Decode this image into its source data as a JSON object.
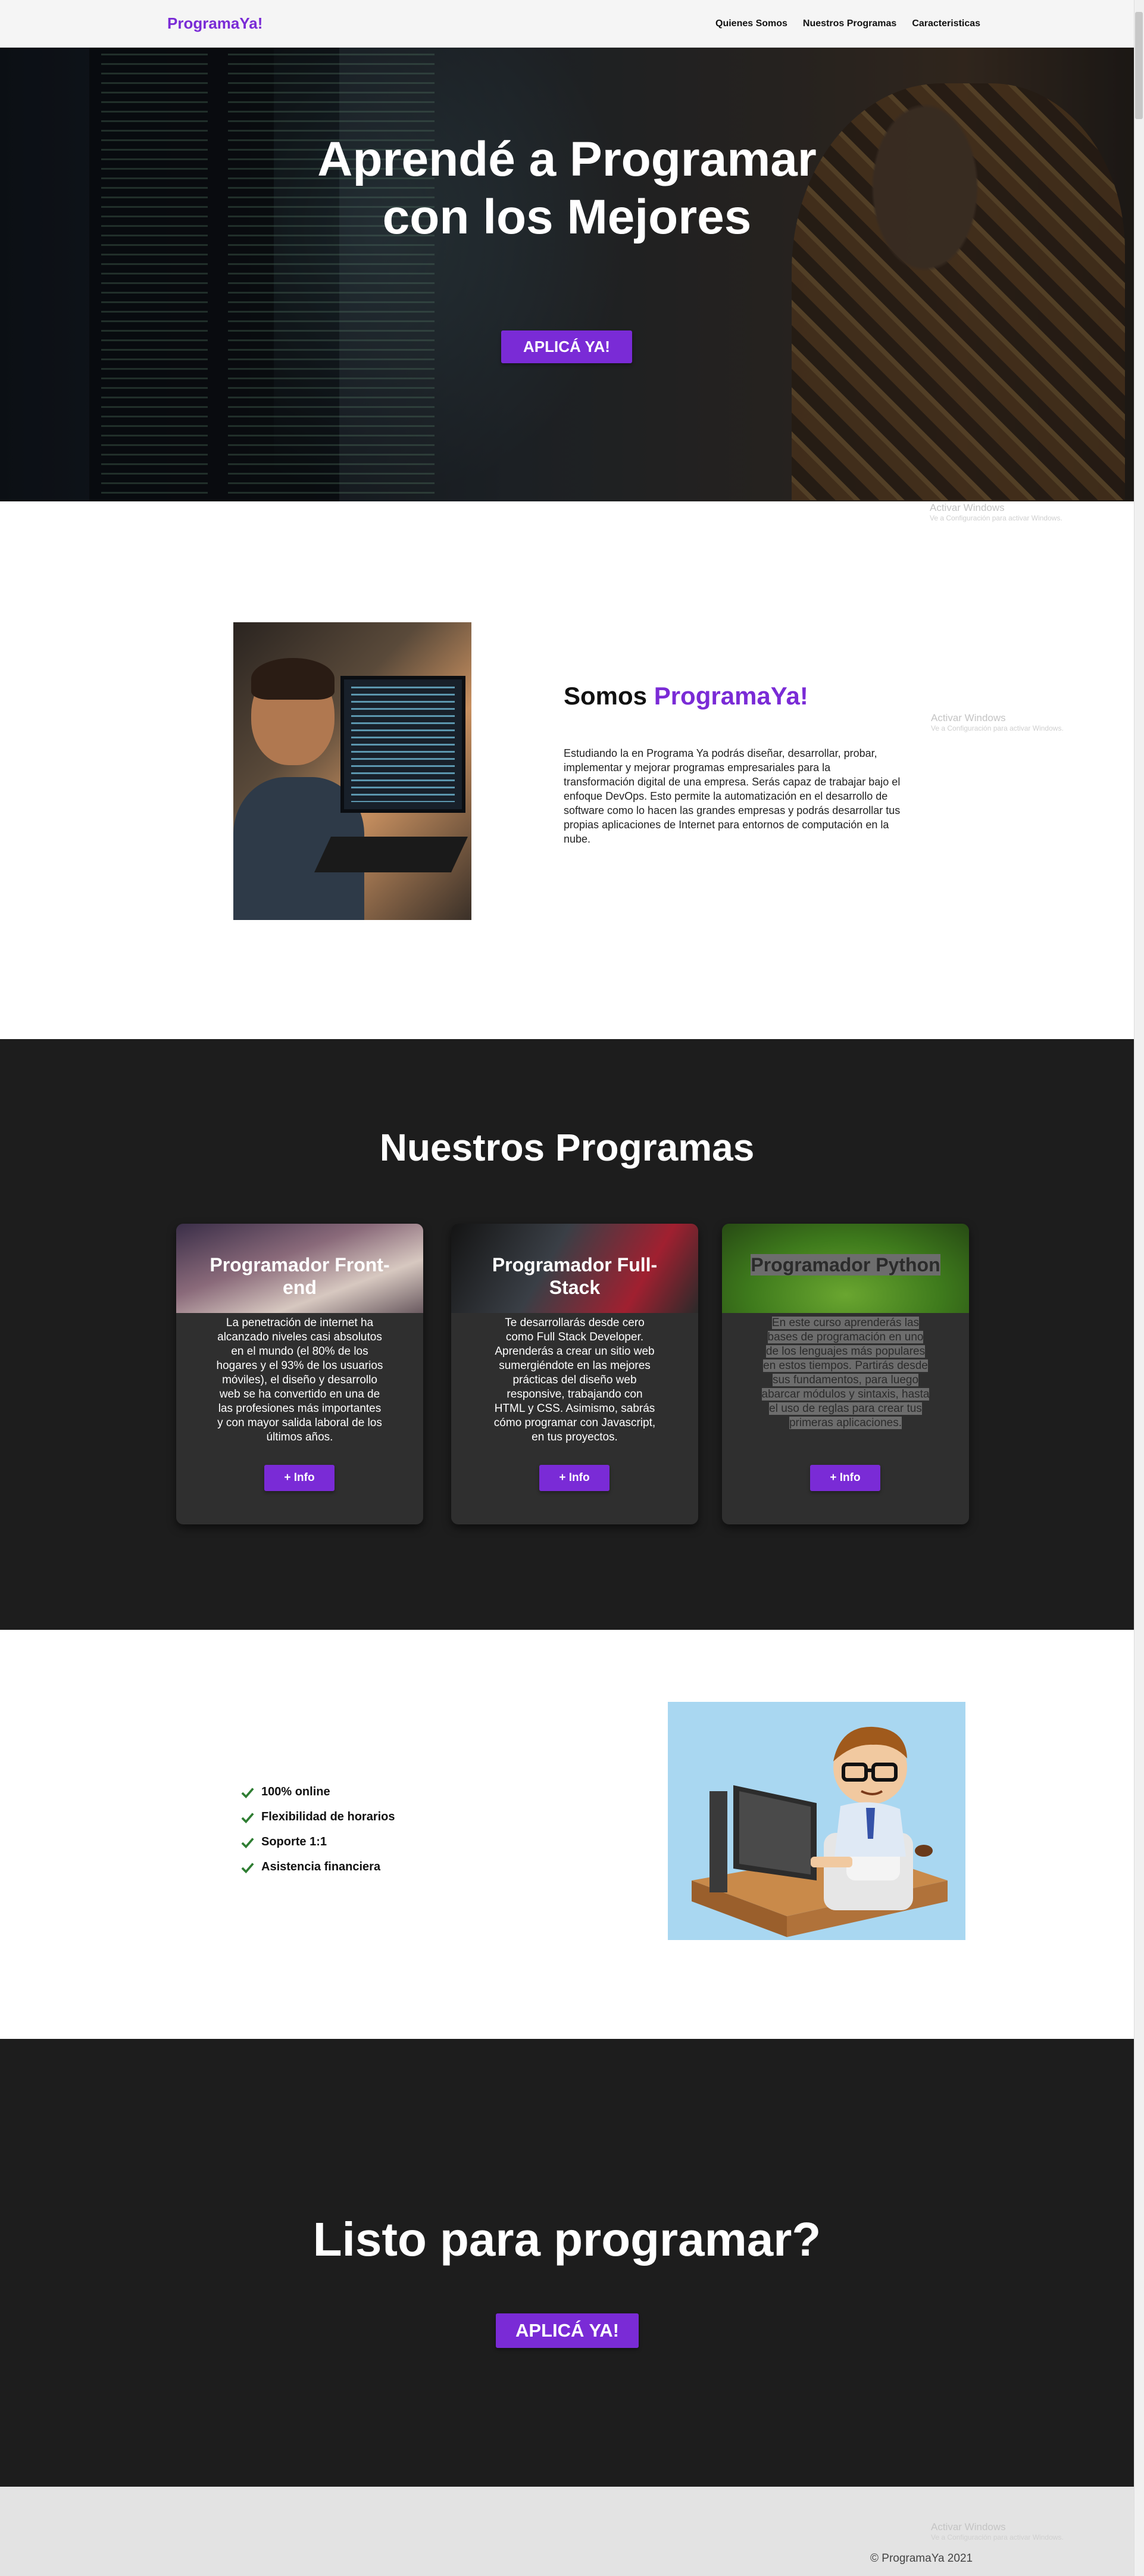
{
  "nav": {
    "brand": "ProgramaYa!",
    "links": [
      "Quienes Somos",
      "Nuestros Programas",
      "Caracteristicas"
    ]
  },
  "hero": {
    "title_line1": "Aprendé a Programar",
    "title_line2": "con los Mejores",
    "cta": "APLICÁ YA!"
  },
  "watermark": {
    "title": "Activar Windows",
    "subtitle": "Ve a Configuración para activar Windows."
  },
  "about": {
    "title_prefix": "Somos",
    "title_accent": "ProgramaYa!",
    "text": "Estudiando la en Programa Ya podrás diseñar, desarrollar, probar, implementar y mejorar programas empresariales para la transformación digital de una empresa. Serás capaz de trabajar bajo el enfoque DevOps. Esto permite la automatización en el desarrollo de software como lo hacen las grandes empresas y podrás desarrollar tus propias aplicaciones de Internet para entornos de computación en la nube."
  },
  "programs": {
    "title": "Nuestros Programas",
    "cards": [
      {
        "title": "Programador Front-end",
        "text": "La penetración de internet ha alcanzado niveles casi absolutos en el mundo (el 80% de los hogares y el 93% de los usuarios móviles), el diseño y desarrollo web se ha convertido en una de las profesiones más importantes y con mayor salida laboral de los últimos años.",
        "button": "+ Info"
      },
      {
        "title": "Programador Full-Stack",
        "text": "Te desarrollarás desde cero como Full Stack Developer. Aprenderás a crear un sitio web sumergiéndote en las mejores prácticas del diseño web responsive, trabajando con HTML y CSS. Asimismo, sabrás cómo programar con Javascript, en tus proyectos.",
        "button": "+ Info"
      },
      {
        "title": "Programador Python",
        "text": "En este curso aprenderás las bases de programación en uno de los lenguajes más populares en estos tiempos. Partirás desde sus fundamentos, para luego abarcar módulos y sintaxis, hasta el uso de reglas para crear tus primeras aplicaciones.",
        "button": "+ Info"
      }
    ]
  },
  "features": {
    "items": [
      "100% online",
      "Flexibilidad de horarios",
      "Soporte 1:1",
      "Asistencia financiera"
    ],
    "check_icon": "check-icon",
    "check_color": "#2e7d32"
  },
  "cta": {
    "title": "Listo para programar?",
    "button": "APLICÁ YA!"
  },
  "footer": {
    "copyright": "© ProgramaYa 2021"
  },
  "colors": {
    "accent": "#7a2bd6",
    "dark_section": "#1d1d1d",
    "footer_bg": "#e3e3e3"
  }
}
